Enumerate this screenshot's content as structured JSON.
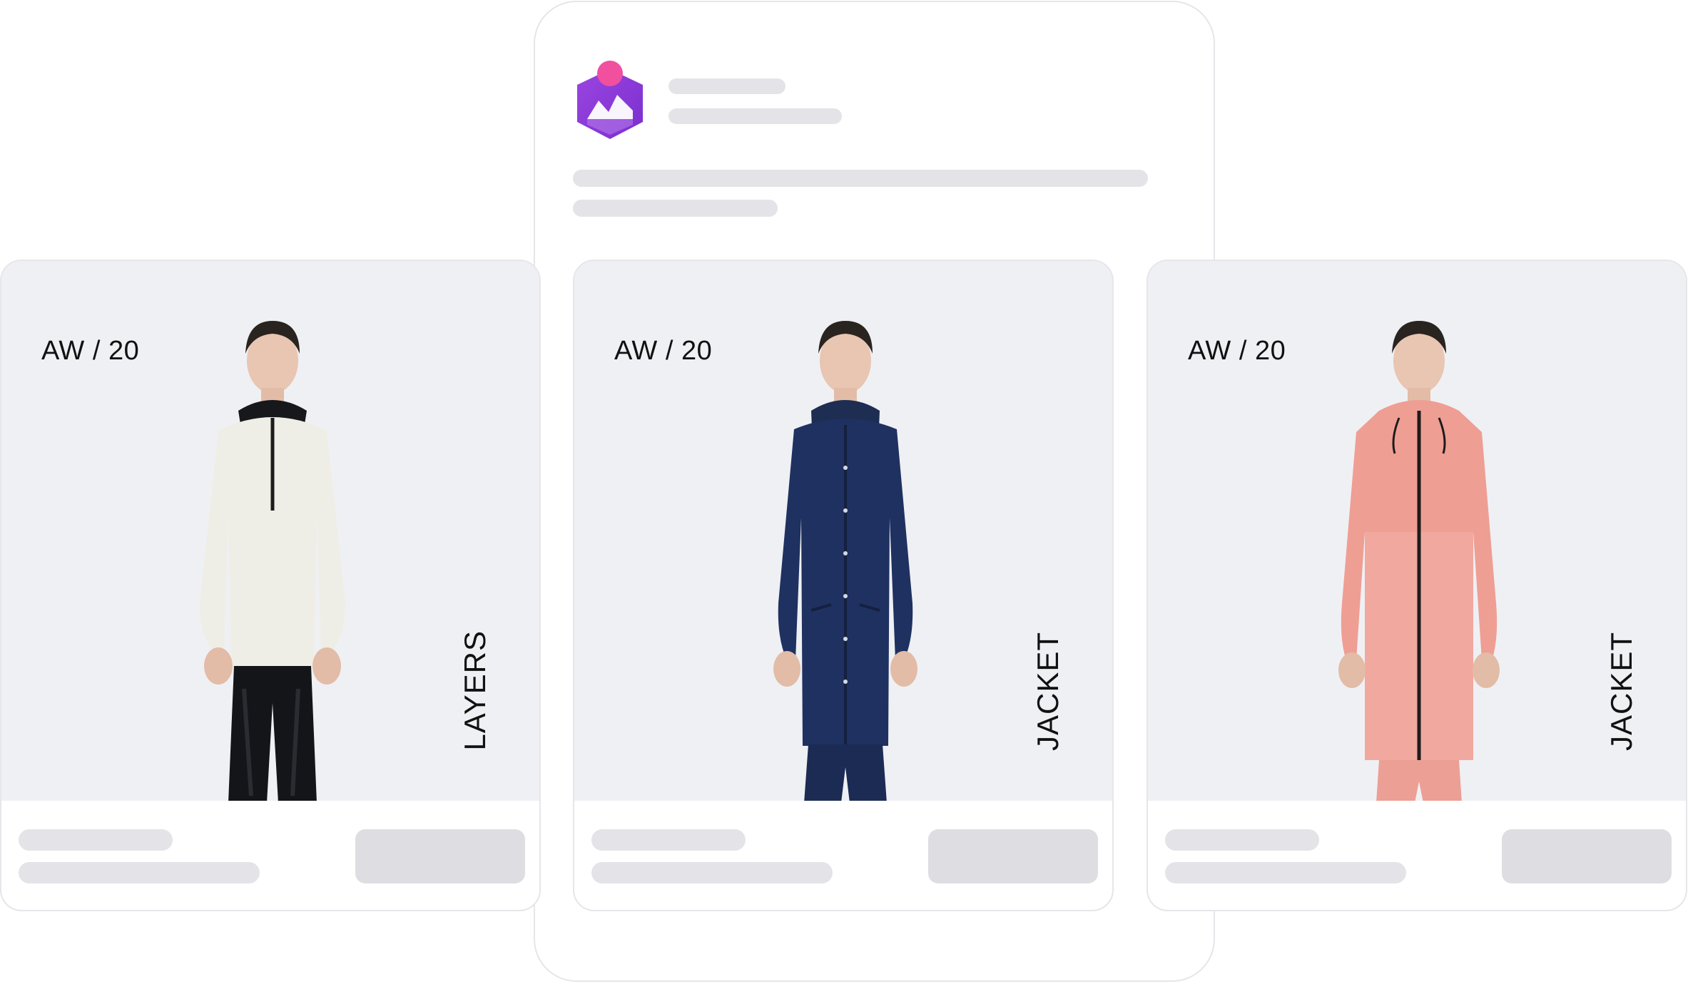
{
  "colors": {
    "brand_purple": "#8b3ad6",
    "brand_pink": "#f0509e",
    "placeholder_gray": "#e4e4e8",
    "photo_background": "#eff0f4"
  },
  "logo": {
    "icon": "crown-chart-logo-icon"
  },
  "products": [
    {
      "season": "AW / 20",
      "category": "LAYERS",
      "garment": "white fleece half-zip with black high-gloss pants"
    },
    {
      "season": "AW / 20",
      "category": "JACKET",
      "garment": "navy long rain jacket"
    },
    {
      "season": "AW / 20",
      "category": "JACKET",
      "garment": "pink translucent parka"
    }
  ]
}
